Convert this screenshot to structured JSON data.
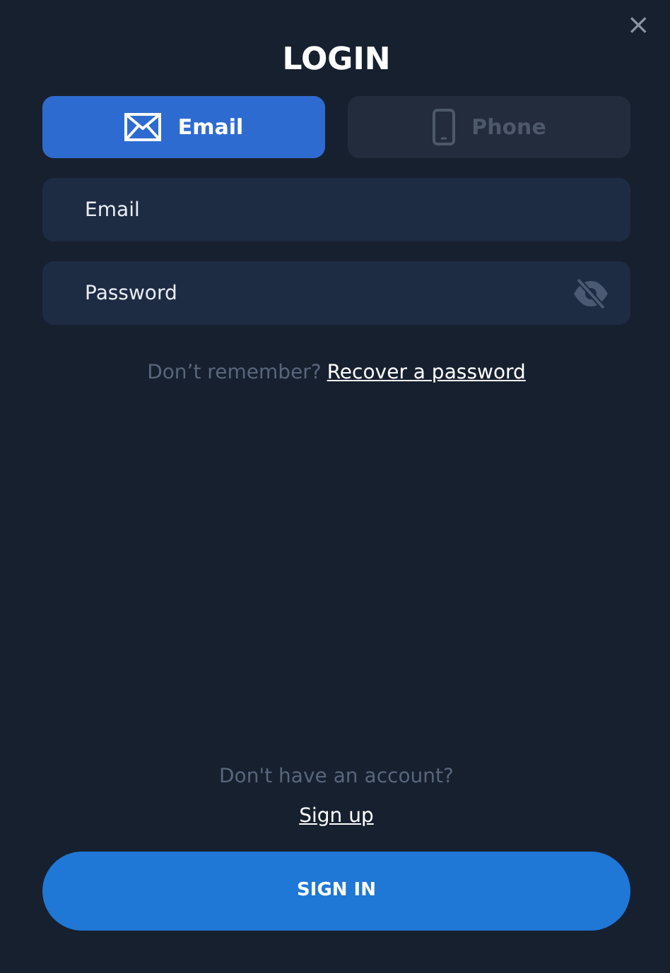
{
  "close": "×",
  "title": "LOGIN",
  "tabs": [
    {
      "label": "Email",
      "kind": "email",
      "selected": true
    },
    {
      "label": "Phone",
      "kind": "phone",
      "selected": false
    }
  ],
  "fields": [
    {
      "placeholder": "Email",
      "kind": "text"
    },
    {
      "placeholder": "Password",
      "kind": "password",
      "visible": false
    }
  ],
  "recover": {
    "prompt": "Don’t remember?",
    "link": "Recover a password"
  },
  "signup": {
    "prompt": "Don't have an account?",
    "link": "Sign up"
  },
  "submit": "SIGN IN"
}
